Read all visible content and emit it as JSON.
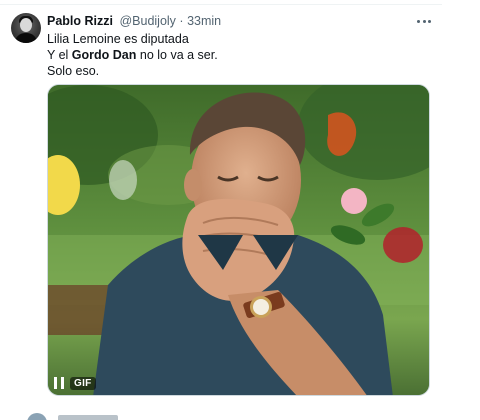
{
  "author": {
    "display_name": "Pablo Rizzi",
    "handle": "@Budijoly",
    "separator": "·",
    "timestamp": "33min"
  },
  "tweet": {
    "line1": "Lilia Lemoine es diputada",
    "line2_pre": "Y el ",
    "line2_bold": "Gordo Dan",
    "line2_post": " no lo va a ser.",
    "line3": "Solo eso."
  },
  "media": {
    "type": "GIF",
    "badge_label": "GIF",
    "controls": [
      "pause-icon"
    ]
  },
  "icons": {
    "more": "more-horizontal-icon",
    "pause": "pause-icon"
  },
  "colors": {
    "text_primary": "#0f1419",
    "text_secondary": "#536471",
    "border": "#cfd9de"
  }
}
